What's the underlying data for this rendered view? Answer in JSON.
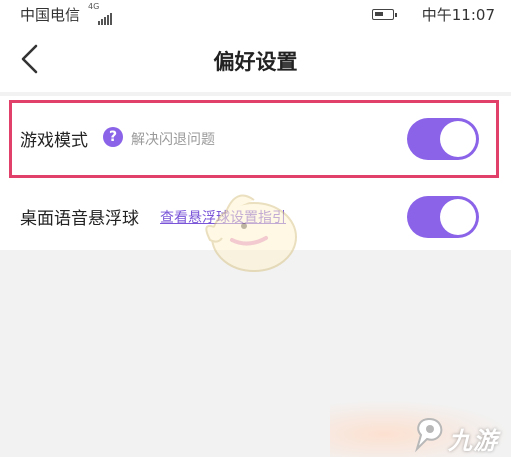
{
  "status_bar": {
    "carrier": "中国电信",
    "network": "4G",
    "time": "中午11:07"
  },
  "header": {
    "title": "偏好设置"
  },
  "settings": [
    {
      "label": "游戏模式",
      "help_icon": "question-icon",
      "hint": "解决闪退问题",
      "enabled": true
    },
    {
      "label": "桌面语音悬浮球",
      "link": "查看悬浮球设置指引",
      "enabled": true
    }
  ],
  "watermark": {
    "brand": "九游"
  },
  "colors": {
    "accent": "#8a63e8",
    "highlight": "#e0406a",
    "background": "#f2f2f2"
  }
}
